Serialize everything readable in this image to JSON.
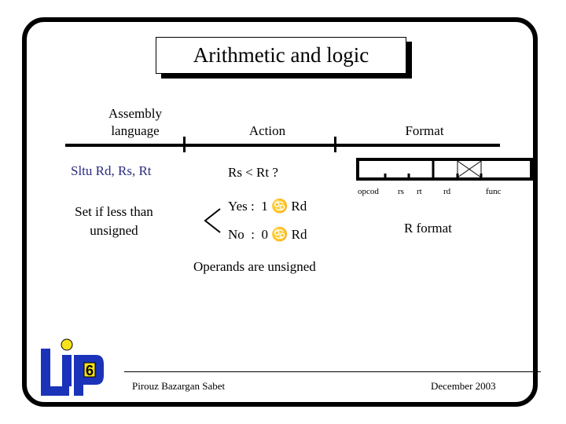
{
  "slide": {
    "title": "Arithmetic and logic",
    "columns": {
      "assembly_line1": "Assembly",
      "assembly_line2": "language",
      "action": "Action",
      "format": "Format"
    },
    "instruction": "Sltu Rd, Rs, Rt",
    "description_line1": "Set if less than",
    "description_line2": "unsigned",
    "condition": "Rs < Rt ?",
    "branch_yes": "Yes :  1 ♋ Rd",
    "branch_no": "No  :  0 ♋ Rd",
    "note": "Operands are unsigned",
    "format_fields": [
      "opcod",
      "rs",
      "rt",
      "rd",
      "func"
    ],
    "format_name": "R format",
    "colors": {
      "instruction": "#2b2b80",
      "logo_blue": "#1a33b8",
      "logo_yellow": "#f7e11a"
    }
  },
  "logo": {
    "name": "LIP6",
    "digit": "6"
  },
  "footer": {
    "author": "Pirouz Bazargan Sabet",
    "date": "December 2003"
  }
}
